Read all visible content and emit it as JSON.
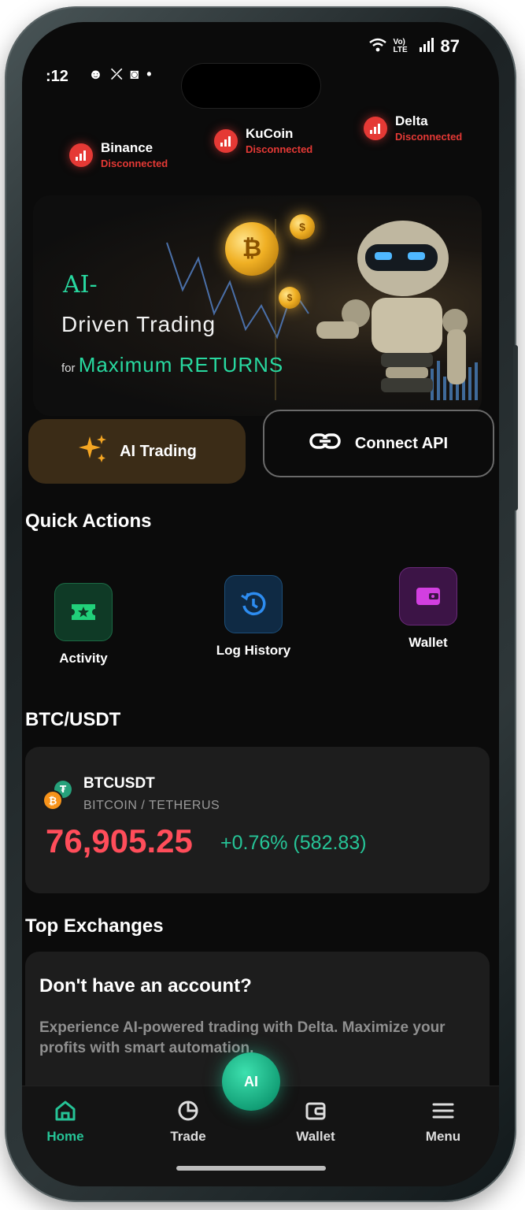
{
  "status_bar": {
    "time": ":12",
    "network": "Vo) LTE",
    "battery": "87"
  },
  "exchanges": [
    {
      "name": "Binance",
      "status": "Disconnected"
    },
    {
      "name": "KuCoin",
      "status": "Disconnected"
    },
    {
      "name": "Delta",
      "status": "Disconnected"
    }
  ],
  "banner": {
    "line1": "AI-",
    "line2": "Driven Trading",
    "line3_prefix": "for",
    "line3_accent": "Maximum RETURNS"
  },
  "actions": {
    "ai_trading": "AI Trading",
    "connect_api": "Connect API"
  },
  "quick_actions": {
    "title": "Quick Actions",
    "items": [
      {
        "label": "Activity",
        "icon": "ticket-star-icon"
      },
      {
        "label": "Log History",
        "icon": "history-icon"
      },
      {
        "label": "Wallet",
        "icon": "wallet-icon"
      }
    ]
  },
  "ticker": {
    "title": "BTC/USDT",
    "symbol": "BTCUSDT",
    "pair": "BITCOIN / TETHERUS",
    "price": "76,905.25",
    "change": "+0.76% (582.83)"
  },
  "top_exchanges": {
    "title": "Top Exchanges",
    "card_title": "Don't have an account?",
    "card_body": "Experience AI-powered trading with Delta. Maximize your profits with smart automation."
  },
  "bottom_nav": {
    "fab": "AI",
    "items": [
      {
        "label": "Home",
        "icon": "home-icon"
      },
      {
        "label": "Trade",
        "icon": "pie-chart-icon"
      },
      {
        "label": "Wallet",
        "icon": "wallet-icon"
      },
      {
        "label": "Menu",
        "icon": "hamburger-menu-icon"
      }
    ]
  },
  "colors": {
    "accent_green": "#26c497",
    "danger_red": "#e53935",
    "price_red": "#ff4d5a",
    "ai_trading_bg": "#3b2c17",
    "screen_bg": "#0b0b0b"
  }
}
